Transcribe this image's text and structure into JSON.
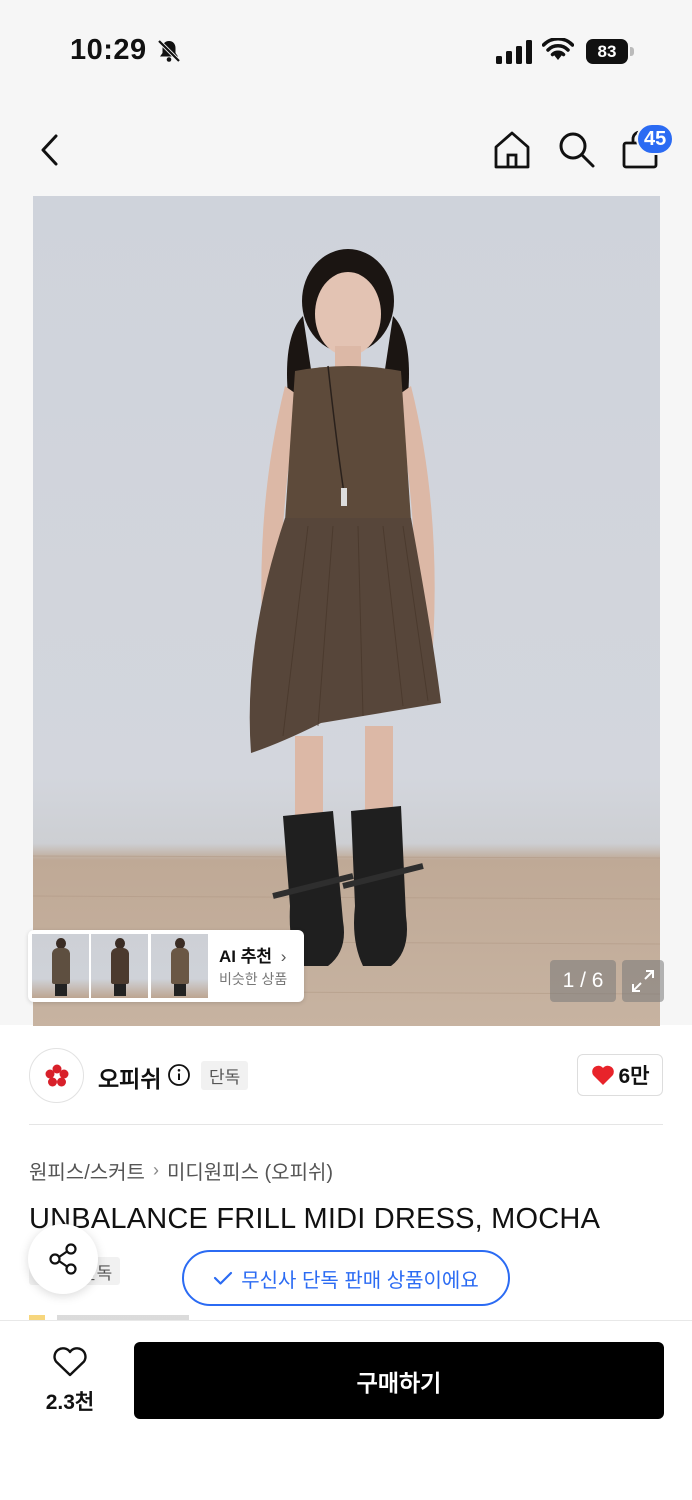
{
  "status_bar": {
    "time": "10:29",
    "battery": "83",
    "icons": [
      "bell-slash-icon",
      "cellular-signal-icon",
      "wifi-icon",
      "battery-icon"
    ]
  },
  "top_nav": {
    "icons": [
      "back-chevron-icon",
      "home-icon",
      "search-icon",
      "shopping-bag-icon"
    ],
    "cart_badge": "45",
    "accent_color": "#2b6bf3"
  },
  "gallery": {
    "page_indicator": "1 / 6",
    "ai_recommend": {
      "title": "AI 추천",
      "subtitle": "비슷한 상품",
      "chevron": "›"
    }
  },
  "brand": {
    "name": "오피쉬",
    "badge": "단독",
    "likes": "6만",
    "like_color": "#e8232a"
  },
  "breadcrumb": {
    "category": "원피스/스커트",
    "subcategory": "미디원피스 (오피쉬)"
  },
  "product": {
    "title": "UNBALANCE FRILL MIDI DRESS, MOCHA",
    "small_badge": "단독",
    "exclusive_banner": "무신사 단독 판매 상품이에요"
  },
  "bottom_bar": {
    "wish_count": "2.3천",
    "buy_label": "구매하기"
  }
}
